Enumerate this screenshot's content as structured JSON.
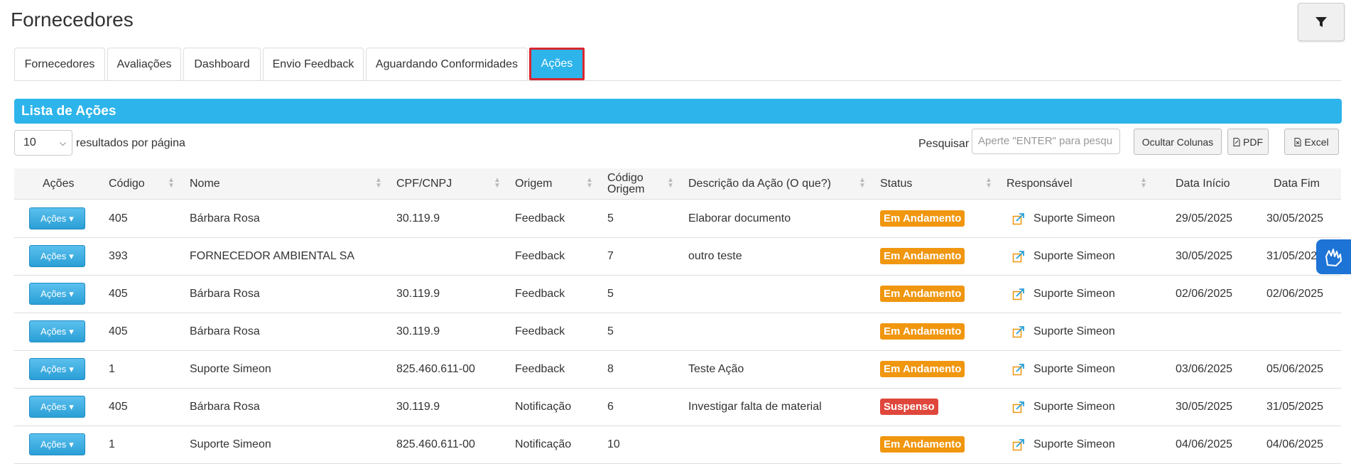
{
  "page": {
    "title": "Fornecedores"
  },
  "tabs": [
    {
      "label": "Fornecedores",
      "active": false
    },
    {
      "label": "Avaliações",
      "active": false
    },
    {
      "label": "Dashboard",
      "active": false
    },
    {
      "label": "Envio Feedback",
      "active": false
    },
    {
      "label": "Aguardando Conformidades",
      "active": false
    },
    {
      "label": "Ações",
      "active": true
    }
  ],
  "section": {
    "title": "Lista de Ações"
  },
  "controls": {
    "page_size": "10",
    "per_page_label": "resultados por página",
    "search_label": "Pesquisar",
    "search_placeholder": "Aperte \"ENTER\" para pesqu",
    "hide_columns_label": "Ocultar Colunas",
    "pdf_label": "PDF",
    "excel_label": "Excel"
  },
  "table": {
    "headers": {
      "acoes": "Ações",
      "codigo": "Código",
      "nome": "Nome",
      "cpf": "CPF/CNPJ",
      "origem": "Origem",
      "codigo_origem_1": "Código",
      "codigo_origem_2": "Origem",
      "descricao": "Descrição da Ação (O que?)",
      "status": "Status",
      "responsavel": "Responsável",
      "data_inicio": "Data Início",
      "data_fim": "Data Fim"
    },
    "action_button_label": "Ações",
    "rows": [
      {
        "codigo": "405",
        "nome": "Bárbara Rosa",
        "cpf": "30.119.9",
        "origem": "Feedback",
        "codigo_origem": "5",
        "descricao": "Elaborar documento",
        "status": "Em Andamento",
        "responsavel": "Suporte Simeon",
        "data_inicio": "29/05/2025",
        "data_fim": "30/05/2025"
      },
      {
        "codigo": "393",
        "nome": "FORNECEDOR AMBIENTAL SA",
        "cpf": "",
        "origem": "Feedback",
        "codigo_origem": "7",
        "descricao": "outro teste",
        "status": "Em Andamento",
        "responsavel": "Suporte Simeon",
        "data_inicio": "30/05/2025",
        "data_fim": "31/05/2025"
      },
      {
        "codigo": "405",
        "nome": "Bárbara Rosa",
        "cpf": "30.119.9",
        "origem": "Feedback",
        "codigo_origem": "5",
        "descricao": "",
        "status": "Em Andamento",
        "responsavel": "Suporte Simeon",
        "data_inicio": "02/06/2025",
        "data_fim": "02/06/2025"
      },
      {
        "codigo": "405",
        "nome": "Bárbara Rosa",
        "cpf": "30.119.9",
        "origem": "Feedback",
        "codigo_origem": "5",
        "descricao": "",
        "status": "Em Andamento",
        "responsavel": "Suporte Simeon",
        "data_inicio": "",
        "data_fim": ""
      },
      {
        "codigo": "1",
        "nome": "Suporte Simeon",
        "cpf": "825.460.611-00",
        "origem": "Feedback",
        "codigo_origem": "8",
        "descricao": "Teste Ação",
        "status": "Em Andamento",
        "responsavel": "Suporte Simeon",
        "data_inicio": "03/06/2025",
        "data_fim": "05/06/2025"
      },
      {
        "codigo": "405",
        "nome": "Bárbara Rosa",
        "cpf": "30.119.9",
        "origem": "Notificação",
        "codigo_origem": "6",
        "descricao": "Investigar falta de material",
        "status": "Suspenso",
        "responsavel": "Suporte Simeon",
        "data_inicio": "30/05/2025",
        "data_fim": "31/05/2025"
      },
      {
        "codigo": "1",
        "nome": "Suporte Simeon",
        "cpf": "825.460.611-00",
        "origem": "Notificação",
        "codigo_origem": "10",
        "descricao": "",
        "status": "Em Andamento",
        "responsavel": "Suporte Simeon",
        "data_inicio": "04/06/2025",
        "data_fim": "04/06/2025"
      }
    ]
  },
  "colors": {
    "primary": "#2db4ea",
    "status_em_andamento": "#f0960f",
    "status_suspenso": "#e0473c",
    "active_tab_outline": "#d9262f"
  }
}
